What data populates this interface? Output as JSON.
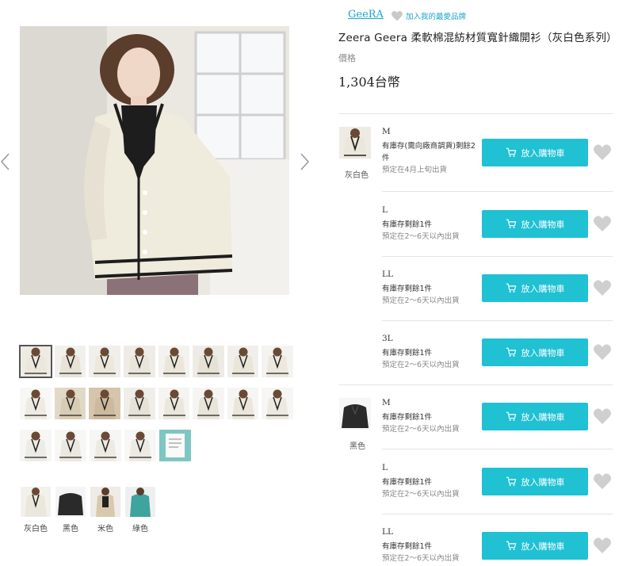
{
  "brand": {
    "name": "GeeRA",
    "favorite_label": "加入我的最愛品牌"
  },
  "product": {
    "title": "Zeera Geera 柔軟棉混紡材質寬針織開衫（灰白色系列）",
    "price_label": "價格",
    "price": "1,304台幣"
  },
  "gallery": {
    "thumb_count": 19,
    "selected_index": 0
  },
  "colors": [
    {
      "label": "灰白色",
      "swatch": "#ece7dc"
    },
    {
      "label": "黑色",
      "swatch": "#2a2a2a"
    },
    {
      "label": "米色",
      "swatch": "#d8c8ad"
    },
    {
      "label": "綠色",
      "swatch": "#3fa3a0"
    }
  ],
  "cart_label": "放入購物車",
  "variants": [
    {
      "color": "灰白色",
      "sizes": [
        {
          "size": "M",
          "stock": "有庫存(需向廠商調貨)剩餘2件",
          "ship": "預定在4月上旬出貨"
        },
        {
          "size": "L",
          "stock": "有庫存剩餘1件",
          "ship": "預定在2～6天以內出貨"
        },
        {
          "size": "LL",
          "stock": "有庫存剩餘1件",
          "ship": "預定在2～6天以內出貨"
        },
        {
          "size": "3L",
          "stock": "有庫存剩餘1件",
          "ship": "預定在2～6天以內出貨"
        }
      ]
    },
    {
      "color": "黑色",
      "sizes": [
        {
          "size": "M",
          "stock": "有庫存剩餘1件",
          "ship": "預定在2～6天以內出貨"
        },
        {
          "size": "L",
          "stock": "有庫存剩餘1件",
          "ship": "預定在2～6天以內出貨"
        },
        {
          "size": "LL",
          "stock": "有庫存剩餘1件",
          "ship": "預定在2～6天以內出貨"
        }
      ]
    }
  ]
}
